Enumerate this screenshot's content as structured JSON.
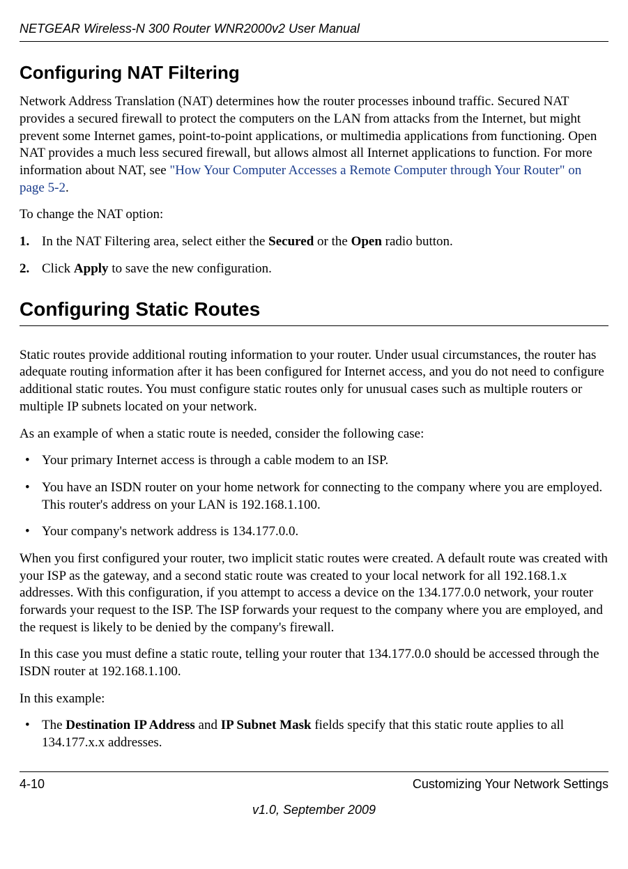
{
  "header": {
    "doc_title": "NETGEAR Wireless-N 300 Router WNR2000v2 User Manual"
  },
  "section1": {
    "title": "Configuring NAT Filtering",
    "para1_part1": "Network Address Translation (NAT) determines how the router processes inbound traffic. Secured NAT provides a secured firewall to protect the computers on the LAN from attacks from the Internet, but might prevent some Internet games, point-to-point applications, or multimedia applications from functioning. Open NAT provides a much less secured firewall, but allows almost all Internet applications to function. For more information about NAT, see ",
    "para1_link": "\"How Your Computer Accesses a Remote Computer through Your Router\" on page 5-2",
    "para1_part2": ".",
    "para2": "To change the NAT option:",
    "step1_num": "1.",
    "step1_part1": "In the NAT Filtering area, select either the ",
    "step1_bold1": "Secured",
    "step1_part2": " or the ",
    "step1_bold2": "Open",
    "step1_part3": " radio button.",
    "step2_num": "2.",
    "step2_part1": "Click ",
    "step2_bold1": "Apply",
    "step2_part2": " to save the new configuration."
  },
  "section2": {
    "title": "Configuring Static Routes",
    "para1": "Static routes provide additional routing information to your router. Under usual circumstances, the router has adequate routing information after it has been configured for Internet access, and you do not need to configure additional static routes. You must configure static routes only for unusual cases such as multiple routers or multiple IP subnets located on your network.",
    "para2": "As an example of when a static route is needed, consider the following case:",
    "bullet1": "Your primary Internet access is through a cable modem to an ISP.",
    "bullet2": "You have an ISDN router on your home network for connecting to the company where you are employed. This router's address on your LAN is 192.168.1.100.",
    "bullet3": "Your company's network address is 134.177.0.0.",
    "para3": "When you first configured your router, two implicit static routes were created. A default route was created with your ISP as the gateway, and a second static route was created to your local network for all 192.168.1.x addresses. With this configuration, if you attempt to access a device on the 134.177.0.0 network, your router forwards your request to the ISP. The ISP forwards your request to the company where you are employed, and the request is likely to be denied by the company's firewall.",
    "para4": "In this case you must define a static route, telling your router that 134.177.0.0 should be accessed through the ISDN router at 192.168.1.100.",
    "para5": "In this example:",
    "bullet4_part1": "The ",
    "bullet4_bold1": "Destination IP Address",
    "bullet4_part2": " and ",
    "bullet4_bold2": "IP Subnet Mask",
    "bullet4_part3": " fields specify that this static route applies to all 134.177.x.x addresses."
  },
  "footer": {
    "page_number": "4-10",
    "chapter": "Customizing Your Network Settings",
    "version": "v1.0, September 2009"
  }
}
